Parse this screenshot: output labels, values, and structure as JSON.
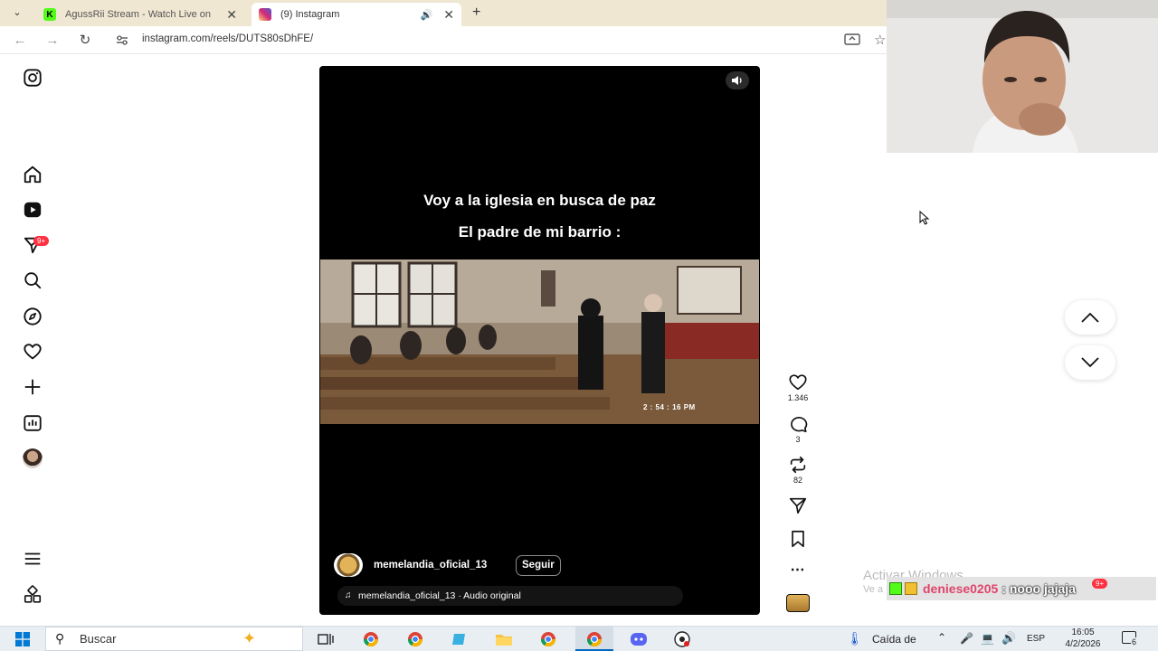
{
  "browser": {
    "tabs": [
      {
        "title": "AgussRii Stream - Watch Live on",
        "active": false
      },
      {
        "title": "(9) Instagram",
        "active": true
      }
    ],
    "url": "instagram.com/reels/DUTS80sDhFE/"
  },
  "sidebar": {
    "notifications_badge": "9+"
  },
  "reel": {
    "caption_line1": "Voy a la iglesia en busca de paz",
    "caption_line2": "El padre de mi barrio :",
    "video_timestamp": "2 : 54 : 16 PM",
    "username": "memelandia_oficial_13",
    "follow_label": "Seguir",
    "audio": "memelandia_oficial_13 · Audio original"
  },
  "actions": {
    "likes": "1.346",
    "comments": "3",
    "reposts": "82"
  },
  "stream_overlay": {
    "watermark_line1": "Activar Windows",
    "watermark_line2": "Ve a",
    "chat_user": "deniese0205",
    "chat_message": ": nooo jajaja",
    "chat_badge": "9+"
  },
  "taskbar": {
    "search_placeholder": "Buscar",
    "weather": "Caída de",
    "language": "ESP",
    "time": "16:05",
    "date": "4/2/2026",
    "notification_count": "6"
  },
  "colors": {
    "tab_strip": "#f0e7d3",
    "instagram_pink": "#e1306c",
    "like_badge": "#ff3040",
    "chat_name": "#e0446b"
  }
}
